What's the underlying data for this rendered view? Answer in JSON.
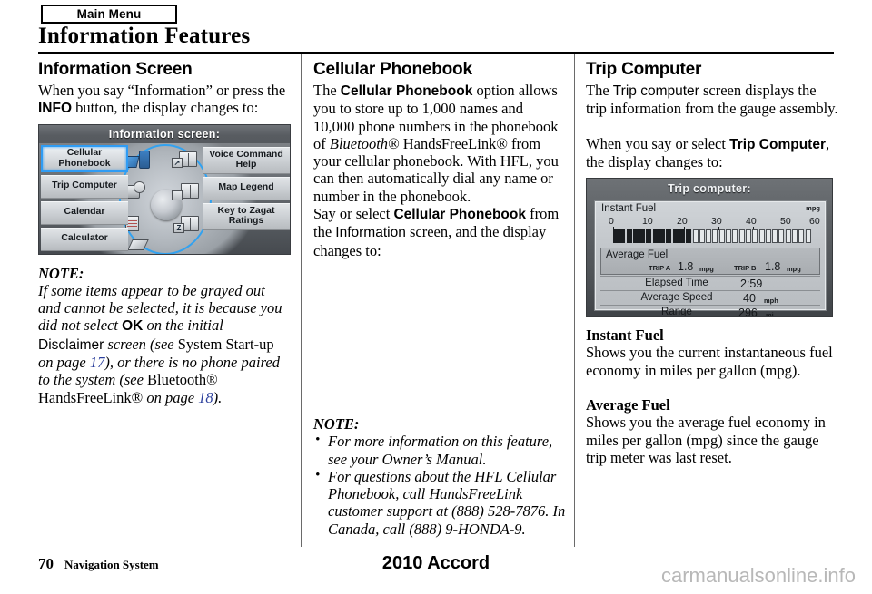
{
  "header": {
    "menu_tab": "Main Menu",
    "page_title": "Information Features"
  },
  "col1": {
    "heading": "Information Screen",
    "p1_a": "When you say “Information” or press the ",
    "p1_info": "INFO",
    "p1_b": " button, the display changes to:",
    "navi_screenshot": {
      "title": "Information screen:",
      "left_items": [
        "Cellular Phonebook",
        "Trip Computer",
        "Calendar",
        "Calculator"
      ],
      "right_items": [
        "Voice Command Help",
        "Map Legend",
        "Key to Zagat Ratings"
      ],
      "selected_item": "Cellular Phonebook",
      "icon_names": [
        "phone-dish-icon",
        "camera-clock-icon",
        "notepad-icon",
        "diamond-book-icon",
        "voice-help-book-icon",
        "map-legend-book-icon",
        "zagat-book-icon"
      ]
    },
    "note": {
      "title": "NOTE:",
      "line1": "If some items appear to be grayed out and cannot be selected, it is because you did not select ",
      "ok": "OK",
      "line2": " on the initial ",
      "disclaimer": "Disclaimer",
      "line3": " screen (see ",
      "sysstart": "System Start-up",
      "line4": " on page ",
      "page17": "17",
      "line5": "), or there is no phone paired to the system (see ",
      "bt": "Bluetooth® HandsFreeLink®",
      "line6": " on page ",
      "page18": "18",
      "line7": ")."
    }
  },
  "col2": {
    "heading": "Cellular Phonebook",
    "p1_a": "The ",
    "p1_b_bold": "Cellular Phonebook",
    "p1_c": " option allows you to store up to 1,000 names and 10,000 phone numbers in the phonebook of ",
    "p1_bt_italic": "Bluetooth®",
    "p1_d": " HandsFreeLink® from your cellular phonebook. With HFL, you can then automatically dial any name or number in the phonebook.",
    "p2_a": "Say or select ",
    "p2_b_bold": "Cellular Phonebook",
    "p2_c": " from the ",
    "p2_d_sans": "Information",
    "p2_e": " screen, and the display changes to:",
    "note": {
      "title": "NOTE:",
      "bullets": [
        "For more information on this feature, see your Owner’s Manual.",
        "For questions about the HFL Cellular Phonebook, call HandsFreeLink customer support at (888) 528-7876. In Canada, call (888) 9-HONDA-9."
      ]
    }
  },
  "col3": {
    "heading": "Trip Computer",
    "p1_a": "The ",
    "p1_b_sans": "Trip computer",
    "p1_c": " screen displays the trip information from the gauge assembly.",
    "p2_a": "When you say or select ",
    "p2_b_bold": "Trip Computer",
    "p2_c": ", the display changes to:",
    "trip_screenshot": {
      "title": "Trip computer:",
      "instant_fuel_label": "Instant Fuel",
      "instant_fuel_unit": "mpg",
      "average_fuel_label": "Average Fuel",
      "trip_a_label": "TRIP A",
      "trip_a_value": "1.8",
      "trip_a_unit": "mpg",
      "trip_b_label": "TRIP B",
      "trip_b_value": "1.8",
      "trip_b_unit": "mpg",
      "rows": [
        {
          "label": "Elapsed Time",
          "value": "2:59",
          "unit": ""
        },
        {
          "label": "Average Speed",
          "value": "40",
          "unit": "mph"
        },
        {
          "label": "Range",
          "value": "296",
          "unit": "mi"
        }
      ]
    },
    "sub1_heading": "Instant Fuel",
    "sub1_body": "Shows you the current instantaneous fuel economy in miles per gallon (mpg).",
    "sub2_heading": "Average Fuel",
    "sub2_body": "Shows you the average fuel economy in miles per gallon (mpg) since the gauge trip meter was last reset."
  },
  "footer": {
    "page_number": "70",
    "section_name": "Navigation System",
    "model": "2010 Accord",
    "watermark": "carmanualsonline.info"
  },
  "chart_data": {
    "type": "bar",
    "title": "Instant Fuel",
    "xlabel": "mpg",
    "ylabel": "",
    "x_ticks": [
      0,
      10,
      20,
      30,
      40,
      50,
      60
    ],
    "xlim": [
      0,
      60
    ],
    "segments_total": 30,
    "segments_filled": 12,
    "value_mpg": 24,
    "grid": false
  },
  "colors": {
    "link": "#2b3f9c",
    "select_highlight": "#2f9cf4",
    "rule": "#000000",
    "watermark": "#b8b8b8"
  }
}
